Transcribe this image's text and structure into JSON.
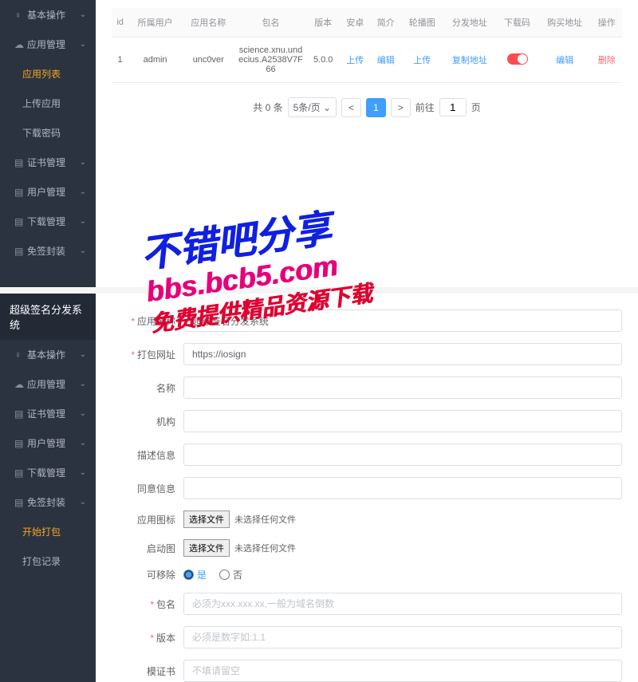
{
  "top": {
    "sidebar": [
      {
        "label": "基本操作",
        "icon": "user",
        "chev": true
      },
      {
        "label": "应用管理",
        "icon": "cloud",
        "chev": true
      },
      {
        "label": "应用列表",
        "icon": "",
        "sub": true,
        "active": true
      },
      {
        "label": "上传应用",
        "icon": "",
        "sub": true
      },
      {
        "label": "下载密码",
        "icon": "",
        "sub": true
      },
      {
        "label": "证书管理",
        "icon": "doc",
        "chev": true
      },
      {
        "label": "用户管理",
        "icon": "doc",
        "chev": true
      },
      {
        "label": "下载管理",
        "icon": "doc",
        "chev": true
      },
      {
        "label": "免签封装",
        "icon": "doc",
        "chev": true
      }
    ],
    "table": {
      "headers": [
        "id",
        "所属用户",
        "应用名称",
        "包名",
        "版本",
        "安卓",
        "简介",
        "轮播图",
        "分发地址",
        "下载码",
        "购买地址",
        "操作"
      ],
      "row": {
        "id": "1",
        "user": "admin",
        "appname": "unc0ver",
        "pkg": "science.xnu.undecius.A2538V7F66",
        "ver": "5.0.0",
        "android": "上传",
        "intro": "编辑",
        "carousel": "上传",
        "dist": "复制地址",
        "buy": "编辑",
        "op": "删除"
      }
    },
    "pager": {
      "total": "共 0 条",
      "perpage": "5条/页",
      "prev": "<",
      "page": "1",
      "next": ">",
      "goto_pre": "前往",
      "goto_val": "1",
      "goto_suf": "页"
    }
  },
  "bottom": {
    "title": "超级签名分发系统",
    "sidebar": [
      {
        "label": "基本操作",
        "icon": "user",
        "chev": true
      },
      {
        "label": "应用管理",
        "icon": "cloud",
        "chev": true
      },
      {
        "label": "证书管理",
        "icon": "doc",
        "chev": true
      },
      {
        "label": "用户管理",
        "icon": "doc",
        "chev": true
      },
      {
        "label": "下载管理",
        "icon": "doc",
        "chev": true
      },
      {
        "label": "免签封装",
        "icon": "doc",
        "chev": true
      },
      {
        "label": "开始打包",
        "icon": "",
        "sub": true,
        "active": true
      },
      {
        "label": "打包记录",
        "icon": "",
        "sub": true
      }
    ],
    "form": {
      "appname_lbl": "应用名称",
      "appname_val": "超级签名分发系统",
      "url_lbl": "打包网址",
      "url_val": "https://iosign",
      "name_lbl": "名称",
      "org_lbl": "机构",
      "desc_lbl": "描述信息",
      "agree_lbl": "同意信息",
      "icon_lbl": "应用图标",
      "splash_lbl": "启动图",
      "file_btn": "选择文件",
      "file_txt": "未选择任何文件",
      "removable_lbl": "可移除",
      "yes": "是",
      "no": "否",
      "pkg_lbl": "包名",
      "pkg_ph": "必须为xxx.xxx.xx,一般为域名倒数",
      "ver_lbl": "版本",
      "ver_ph": "必须是数字如:1.1",
      "cert_lbl": "模证书",
      "cert_ph": "不填请留空"
    }
  },
  "watermark": {
    "line1": "不错吧分享",
    "line2": "bbs.bcb5.com",
    "line3": "免费提供精品资源下载"
  }
}
